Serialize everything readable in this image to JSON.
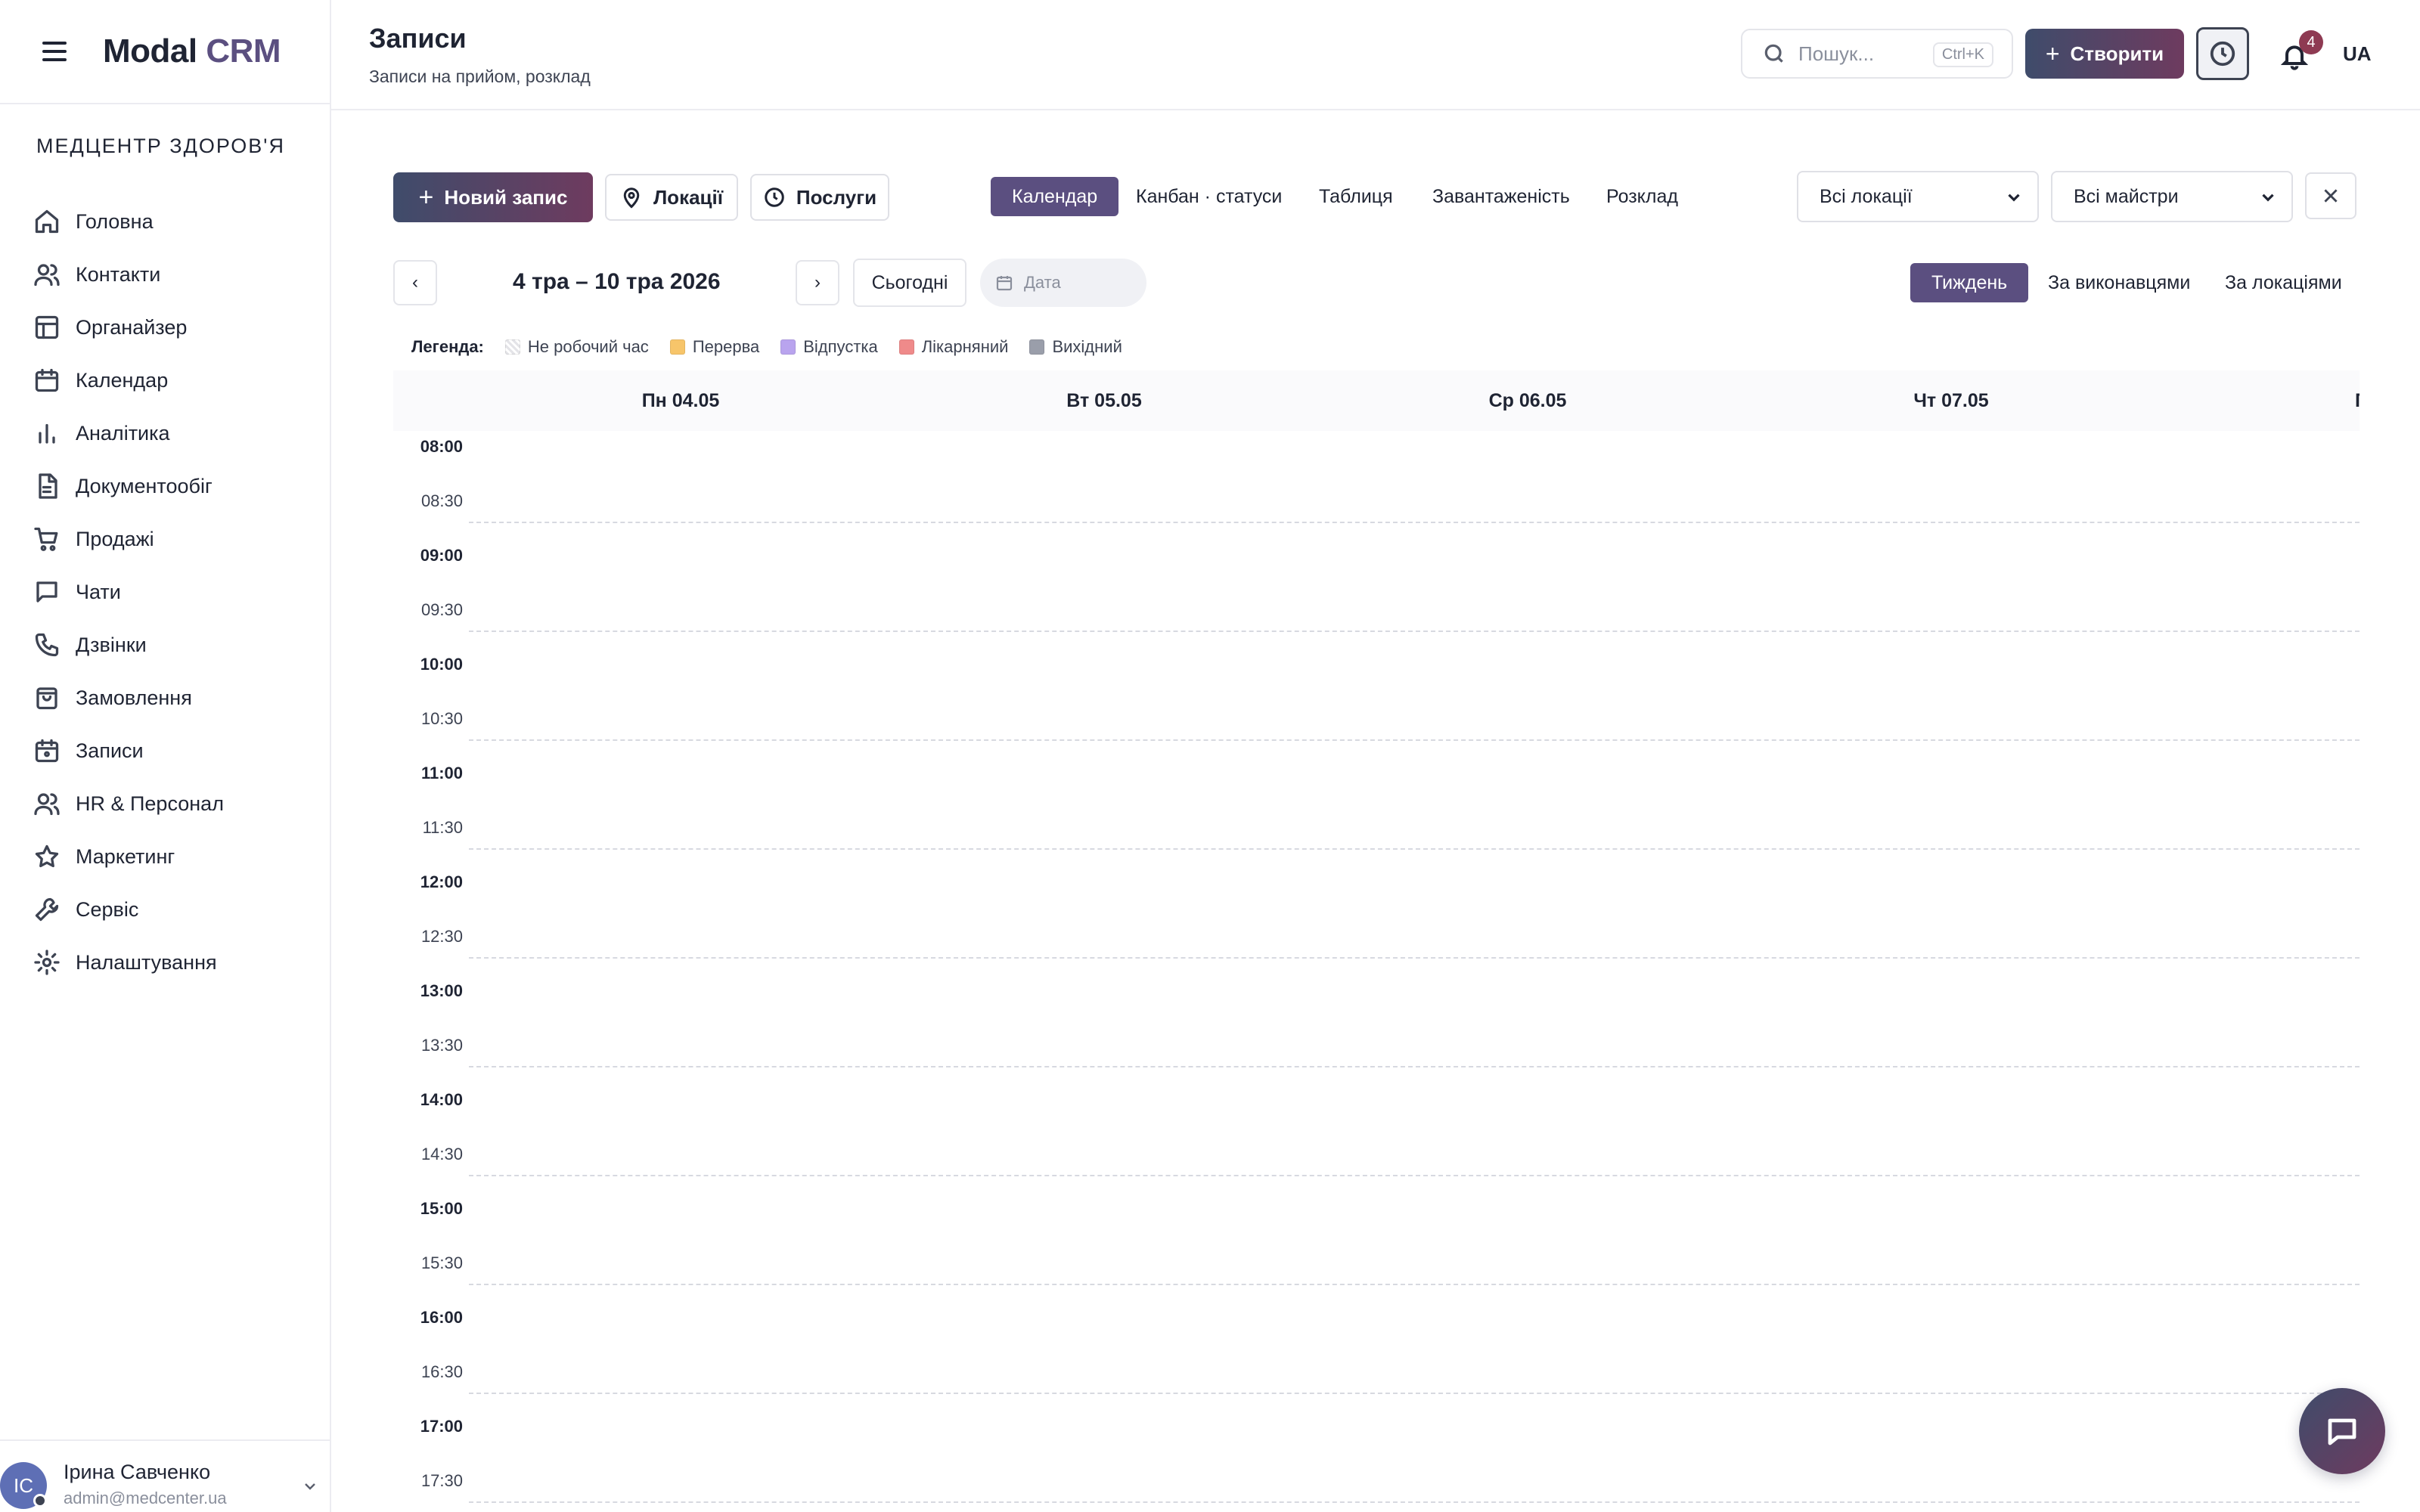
{
  "app": {
    "logo_main": "Modal",
    "logo_accent": "CRM",
    "organization": "МЕДЦЕНТР ЗДОРОВ'Я"
  },
  "sidebar": {
    "items": [
      {
        "label": "Головна",
        "icon": "home-icon"
      },
      {
        "label": "Контакти",
        "icon": "users-icon"
      },
      {
        "label": "Органайзер",
        "icon": "layout-icon"
      },
      {
        "label": "Календар",
        "icon": "calendar-icon"
      },
      {
        "label": "Аналітика",
        "icon": "bar-chart-icon"
      },
      {
        "label": "Документообіг",
        "icon": "document-icon"
      },
      {
        "label": "Продажі",
        "icon": "cart-icon"
      },
      {
        "label": "Чати",
        "icon": "chat-icon"
      },
      {
        "label": "Дзвінки",
        "icon": "phone-icon"
      },
      {
        "label": "Замовлення",
        "icon": "shopping-bag-icon"
      },
      {
        "label": "Записи",
        "icon": "calendar-check-icon"
      },
      {
        "label": "HR & Персонал",
        "icon": "team-icon"
      },
      {
        "label": "Маркетинг",
        "icon": "star-icon"
      },
      {
        "label": "Сервіс",
        "icon": "wrench-icon"
      },
      {
        "label": "Налаштування",
        "icon": "gear-icon"
      }
    ],
    "user": {
      "initials": "IC",
      "name": "Ірина Савченко",
      "email": "admin@medcenter.ua"
    }
  },
  "header": {
    "title": "Записи",
    "subtitle": "Записи на прийом, розклад",
    "search_placeholder": "Пошук...",
    "search_shortcut": "Ctrl+K",
    "create_label": "Створити",
    "notifications_count": "4",
    "language": "UA"
  },
  "toolbar": {
    "new_record": "Новий запис",
    "locations": "Локації",
    "services": "Послуги",
    "view_tabs": [
      "Календар",
      "Канбан · статуси",
      "Таблиця",
      "Завантаженість",
      "Розклад"
    ],
    "active_view": "Календар",
    "location_filter": "Всі локації",
    "master_filter": "Всі майстри"
  },
  "calendar": {
    "prev": "‹",
    "next": "›",
    "range": "4 тра – 10 тра 2026",
    "today": "Сьогодні",
    "date_placeholder": "Дата",
    "modes": [
      "Тиждень",
      "За виконавцями",
      "За локаціями"
    ],
    "active_mode": "Тиждень",
    "legend_title": "Легенда:",
    "legend": [
      {
        "label": "Не робочий час",
        "color": "#eeeeee"
      },
      {
        "label": "Перерва",
        "color": "#f7c56a"
      },
      {
        "label": "Відпустка",
        "color": "#b9a4ee"
      },
      {
        "label": "Лікарняний",
        "color": "#ef8a8a"
      },
      {
        "label": "Вихідний",
        "color": "#9a9eaa"
      }
    ],
    "days": [
      "Пн 04.05",
      "Вт 05.05",
      "Ср 06.05",
      "Чт 07.05",
      "Пт"
    ],
    "times": [
      "08:00",
      "08:30",
      "09:00",
      "09:30",
      "10:00",
      "10:30",
      "11:00",
      "11:30",
      "12:00",
      "12:30",
      "13:00",
      "13:30",
      "14:00",
      "14:30",
      "15:00",
      "15:30",
      "16:00",
      "16:30",
      "17:00",
      "17:30"
    ]
  },
  "colors": {
    "accent": "#5b4f80",
    "gradient_start": "#3f4c6b",
    "gradient_end": "#6e3b5f",
    "badge": "#8e3a52"
  }
}
